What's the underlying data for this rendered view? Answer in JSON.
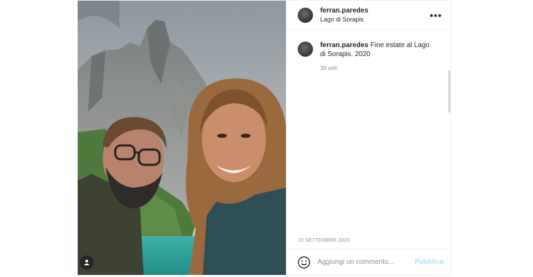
{
  "post": {
    "username": "ferran.paredes",
    "location": "Lago di Sorapis",
    "more_icon": "more-horizontal-icon",
    "tag_icon": "user-tag-icon"
  },
  "caption": {
    "username": "ferran.paredes",
    "text": "Fine estate al Lago di Sorapis. 2020",
    "time_ago": "39 sett."
  },
  "date": "20 SETTEMBRE 2020",
  "comment_box": {
    "emoji_icon": "smiley-icon",
    "placeholder": "Aggiungi un commento...",
    "publish_label": "Pubblica"
  },
  "colors": {
    "publish_disabled": "#b2dffc",
    "text": "#262626",
    "muted": "#8e8e8e",
    "border": "#efefef"
  }
}
